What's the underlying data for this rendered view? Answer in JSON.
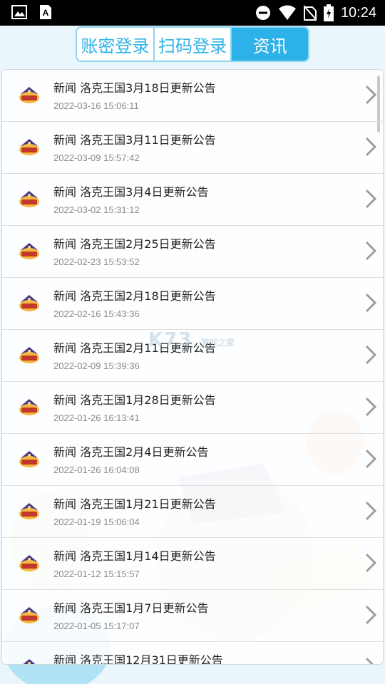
{
  "status_bar": {
    "time": "10:24",
    "icons": [
      "image-icon",
      "text-a-icon",
      "minus-circle-icon",
      "wifi-icon",
      "no-sim-icon",
      "battery-icon"
    ]
  },
  "tabs": [
    {
      "label": "账密登录",
      "active": false
    },
    {
      "label": "扫码登录",
      "active": false
    },
    {
      "label": "资讯",
      "active": true
    }
  ],
  "news": [
    {
      "title": "新闻 洛克王国3月18日更新公告",
      "date": "2022-03-16 15:06:11"
    },
    {
      "title": "新闻 洛克王国3月11日更新公告",
      "date": "2022-03-09 15:57:42"
    },
    {
      "title": "新闻 洛克王国3月4日更新公告",
      "date": "2022-03-02 15:31:12"
    },
    {
      "title": "新闻 洛克王国2月25日更新公告",
      "date": "2022-02-23 15:53:52"
    },
    {
      "title": "新闻 洛克王国2月18日更新公告",
      "date": "2022-02-16 15:43:36"
    },
    {
      "title": "新闻 洛克王国2月11日更新公告",
      "date": "2022-02-09 15:39:36"
    },
    {
      "title": "新闻 洛克王国1月28日更新公告",
      "date": "2022-01-26 16:13:41"
    },
    {
      "title": "新闻 洛克王国2月4日更新公告",
      "date": "2022-01-26 16:04:08"
    },
    {
      "title": "新闻 洛克王国1月21日更新公告",
      "date": "2022-01-19 15:06:04"
    },
    {
      "title": "新闻 洛克王国1月14日更新公告",
      "date": "2022-01-12 15:15:57"
    },
    {
      "title": "新闻 洛克王国1月7日更新公告",
      "date": "2022-01-05 15:17:07"
    },
    {
      "title": "新闻 洛克王国12月31日更新公告",
      "date": ""
    }
  ],
  "watermark": {
    "brand": "K73",
    "sub": "游戏之家"
  },
  "colors": {
    "accent": "#2cb1e8",
    "tab_border": "#8fd6ee"
  }
}
